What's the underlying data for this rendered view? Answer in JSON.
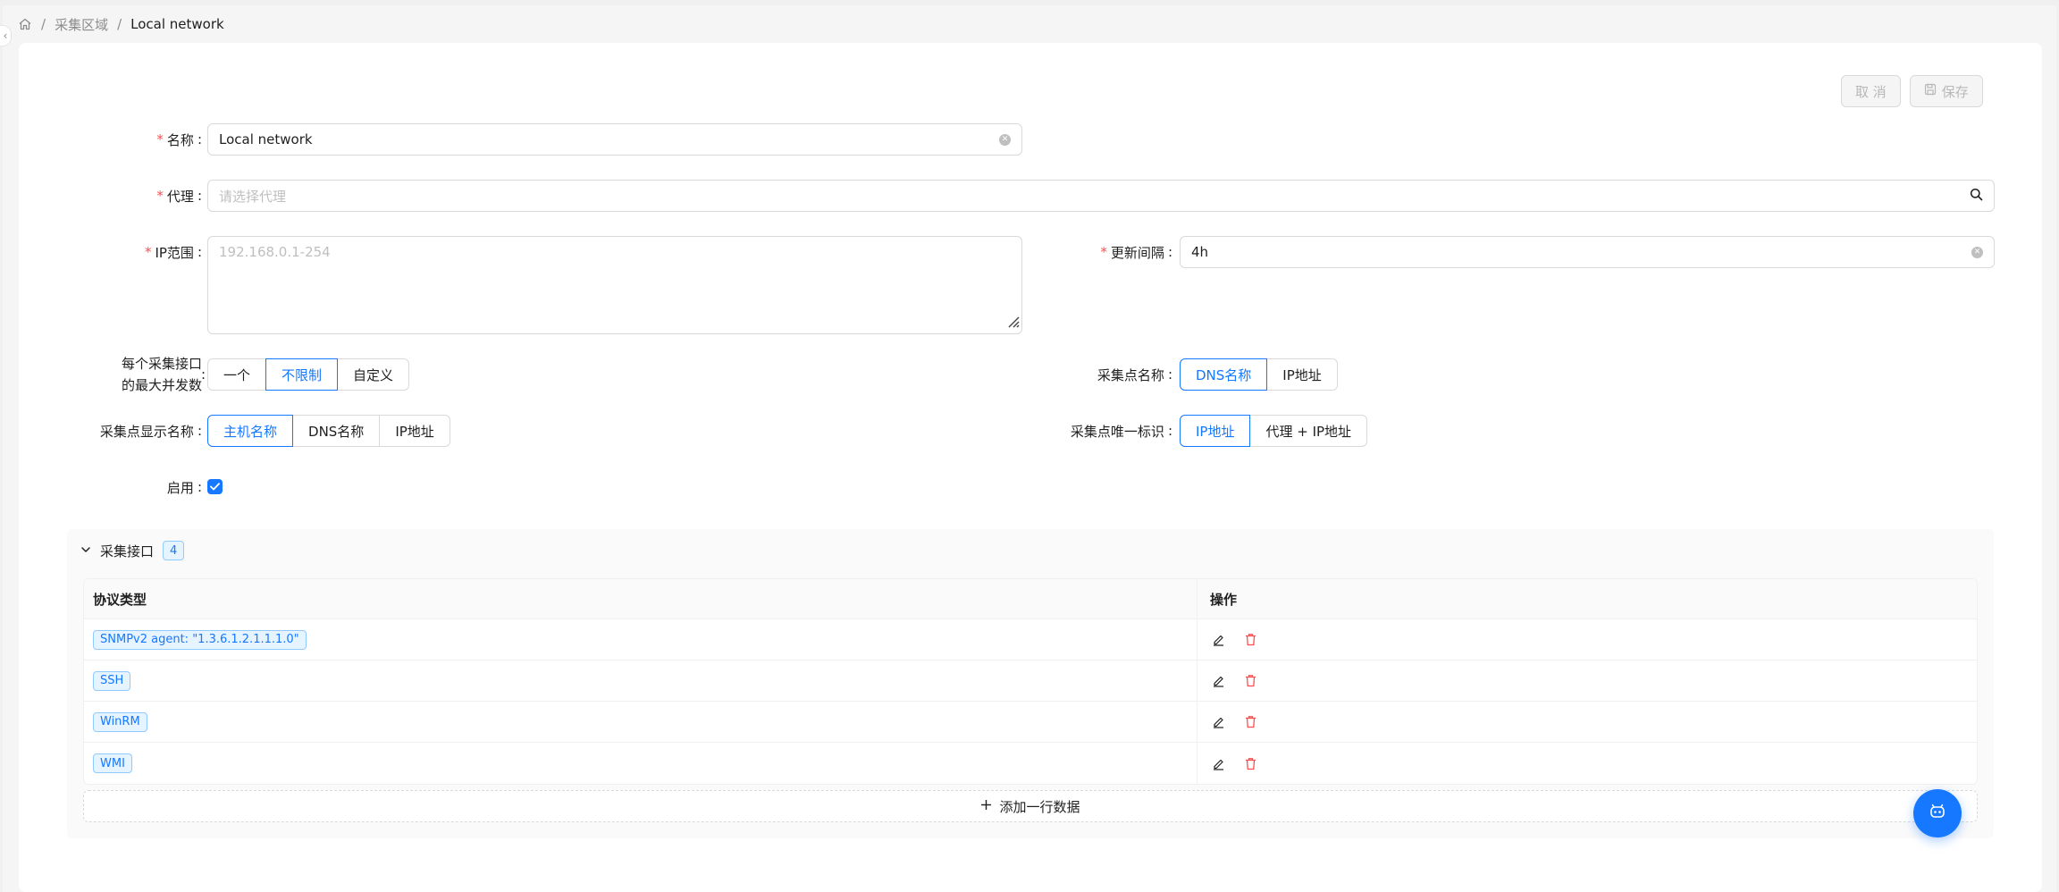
{
  "breadcrumb": {
    "home_icon": "home-icon",
    "items": [
      "采集区域",
      "Local network"
    ],
    "separator": "/"
  },
  "actions": {
    "cancel_label": "取 消",
    "save_label": "保存"
  },
  "form": {
    "name": {
      "label": "名称",
      "value": "Local network",
      "required": true
    },
    "proxy": {
      "label": "代理",
      "placeholder": "请选择代理",
      "required": true
    },
    "ip_range": {
      "label": "IP范围",
      "placeholder": "192.168.0.1-254",
      "required": true
    },
    "update_interval": {
      "label": "更新间隔",
      "value": "4h",
      "required": true
    },
    "max_concurrency": {
      "label_line1": "每个采集接口",
      "label_line2": "的最大并发数",
      "options": [
        "一个",
        "不限制",
        "自定义"
      ],
      "selected": "不限制"
    },
    "collect_point_name": {
      "label": "采集点名称",
      "options": [
        "DNS名称",
        "IP地址"
      ],
      "selected": "DNS名称"
    },
    "display_name": {
      "label": "采集点显示名称",
      "options": [
        "主机名称",
        "DNS名称",
        "IP地址"
      ],
      "selected": "主机名称"
    },
    "unique_id": {
      "label": "采集点唯一标识",
      "options": [
        "IP地址",
        "代理 + IP地址"
      ],
      "selected": "IP地址"
    },
    "enabled": {
      "label": "启用",
      "checked": true
    },
    "colon": ":"
  },
  "interfaces": {
    "title": "采集接口",
    "count": "4",
    "columns": [
      "协议类型",
      "操作"
    ],
    "rows": [
      {
        "protocol": "SNMPv2 agent: \"1.3.6.1.2.1.1.1.0\""
      },
      {
        "protocol": "SSH"
      },
      {
        "protocol": "WinRM"
      },
      {
        "protocol": "WMI"
      }
    ],
    "add_label": "添加一行数据"
  },
  "colors": {
    "primary": "#1677ff",
    "danger": "#ff4d4f",
    "border": "#d9d9d9"
  }
}
